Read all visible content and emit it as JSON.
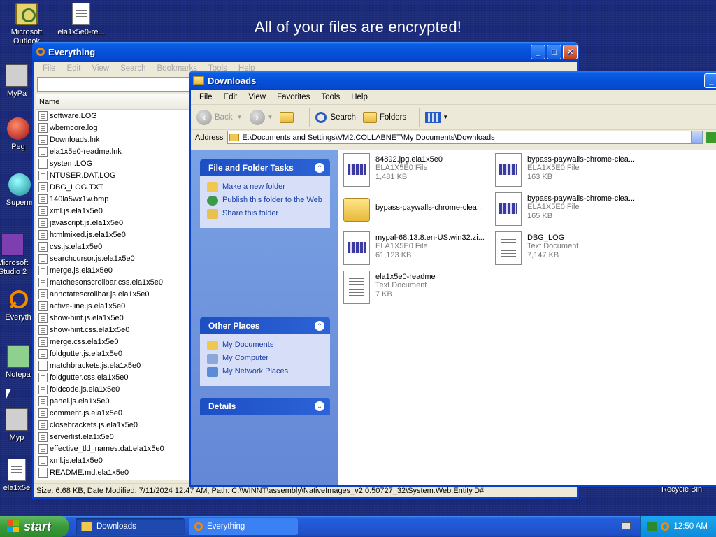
{
  "desktop": {
    "banner": "All of your files are encrypted!",
    "icons": [
      {
        "label": "Microsoft Outlook",
        "icon": "outlook-icon"
      },
      {
        "label": "ela1x5e0-re...",
        "icon": "document-icon"
      },
      {
        "label": "MyPa",
        "icon": "puzzle-icon"
      },
      {
        "label": "Peg",
        "icon": "orb-icon"
      },
      {
        "label": "Superm",
        "icon": "orb-green-icon"
      },
      {
        "label": "Microsoft Studio 2",
        "icon": "visual-studio-icon"
      },
      {
        "label": "Everyth",
        "icon": "search-icon"
      },
      {
        "label": "Notepa",
        "icon": "notepad-icon"
      },
      {
        "label": "Myp",
        "icon": "puzzle-icon"
      },
      {
        "label": "ela1x5e",
        "icon": "document-icon"
      }
    ],
    "recycle_bin": "Recycle Bin"
  },
  "everything": {
    "title": "Everything",
    "menu": [
      "File",
      "Edit",
      "View",
      "Search",
      "Bookmarks",
      "Tools",
      "Help"
    ],
    "column_name": "Name",
    "files": [
      "software.LOG",
      "wbemcore.log",
      "Downloads.lnk",
      "ela1x5e0-readme.lnk",
      "system.LOG",
      "NTUSER.DAT.LOG",
      "DBG_LOG.TXT",
      "140la5wx1w.bmp",
      "xml.js.ela1x5e0",
      "javascript.js.ela1x5e0",
      "htmlmixed.js.ela1x5e0",
      "css.js.ela1x5e0",
      "searchcursor.js.ela1x5e0",
      "merge.js.ela1x5e0",
      "matchesonscrollbar.css.ela1x5e0",
      "annotatescrollbar.js.ela1x5e0",
      "active-line.js.ela1x5e0",
      "show-hint.js.ela1x5e0",
      "show-hint.css.ela1x5e0",
      "merge.css.ela1x5e0",
      "foldgutter.js.ela1x5e0",
      "matchbrackets.js.ela1x5e0",
      "foldgutter.css.ela1x5e0",
      "foldcode.js.ela1x5e0",
      "panel.js.ela1x5e0",
      "comment.js.ela1x5e0",
      "closebrackets.js.ela1x5e0",
      "serverlist.ela1x5e0",
      "effective_tld_names.dat.ela1x5e0",
      "xml.js.ela1x5e0",
      "README.md.ela1x5e0"
    ],
    "status": "Size: 6.68 KB, Date Modified: 7/11/2024 12:47 AM, Path: C:\\WINNT\\assembly\\NativeImages_v2.0.50727_32\\System.Web.Entity.D#"
  },
  "downloads": {
    "title": "Downloads",
    "menu": [
      "File",
      "Edit",
      "View",
      "Favorites",
      "Tools",
      "Help"
    ],
    "toolbar": {
      "back": "Back",
      "search": "Search",
      "folders": "Folders"
    },
    "address_label": "Address",
    "address": "E:\\Documents and Settings\\VM2.COLLABNET\\My Documents\\Downloads",
    "file_tasks": {
      "title": "File and Folder Tasks",
      "links": [
        "Make a new folder",
        "Publish this folder to the Web",
        "Share this folder"
      ]
    },
    "other_places": {
      "title": "Other Places",
      "links": [
        "My Documents",
        "My Computer",
        "My Network Places"
      ]
    },
    "details": {
      "title": "Details"
    },
    "items": [
      {
        "name": "84892.jpg.ela1x5e0",
        "type": "ELA1X5E0 File",
        "size": "1,481 KB",
        "icon": "encrypted-file-icon"
      },
      {
        "name": "bypass-paywalls-chrome-clea...",
        "type": "ELA1X5E0 File",
        "size": "163 KB",
        "icon": "encrypted-file-icon"
      },
      {
        "name": "bypass-paywalls-chrome-clea...",
        "type": "",
        "size": "",
        "icon": "folder-icon"
      },
      {
        "name": "bypass-paywalls-chrome-clea...",
        "type": "ELA1X5E0 File",
        "size": "165 KB",
        "icon": "encrypted-file-icon"
      },
      {
        "name": "mypal-68.13.8.en-US.win32.zi...",
        "type": "ELA1X5E0 File",
        "size": "61,123 KB",
        "icon": "encrypted-file-icon"
      },
      {
        "name": "DBG_LOG",
        "type": "Text Document",
        "size": "7,147 KB",
        "icon": "text-document-icon"
      },
      {
        "name": "ela1x5e0-readme",
        "type": "Text Document",
        "size": "7 KB",
        "icon": "text-document-icon"
      }
    ]
  },
  "taskbar": {
    "start": "start",
    "tasks": [
      "Downloads",
      "Everything"
    ],
    "clock": "12:50 AM"
  }
}
